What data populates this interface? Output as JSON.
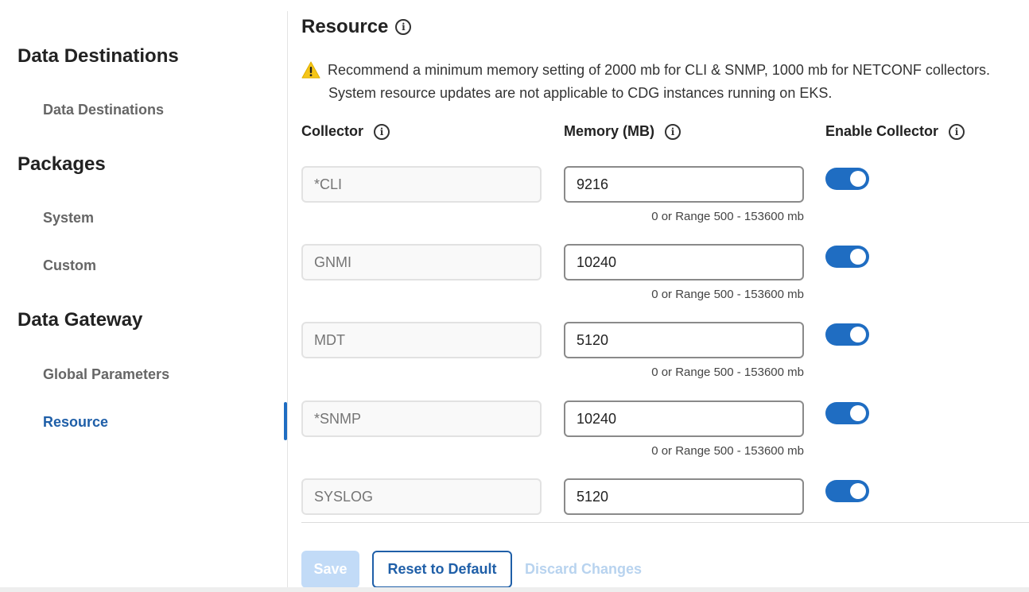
{
  "sidebar": {
    "sections": [
      {
        "heading": "Data Destinations",
        "items": [
          "Data Destinations"
        ]
      },
      {
        "heading": "Packages",
        "items": [
          "System",
          "Custom"
        ]
      },
      {
        "heading": "Data Gateway",
        "items": [
          "Global Parameters",
          "Resource"
        ]
      }
    ],
    "active_item": "Resource"
  },
  "main": {
    "title": "Resource",
    "warning": {
      "line1": "Recommend a minimum memory setting of 2000 mb for CLI & SNMP, 1000 mb for NETCONF collectors.",
      "line2": "System resource updates are not applicable to CDG instances running on EKS."
    },
    "columns": {
      "collector": "Collector",
      "memory": "Memory (MB)",
      "enable": "Enable Collector"
    },
    "rows": [
      {
        "collector": "*CLI",
        "memory": "9216",
        "hint": "0 or Range 500 - 153600 mb",
        "enabled": true
      },
      {
        "collector": "GNMI",
        "memory": "10240",
        "hint": "0 or Range 500 - 153600 mb",
        "enabled": true
      },
      {
        "collector": "MDT",
        "memory": "5120",
        "hint": "0 or Range 500 - 153600 mb",
        "enabled": true
      },
      {
        "collector": "*SNMP",
        "memory": "10240",
        "hint": "0 or Range 500 - 153600 mb",
        "enabled": true
      },
      {
        "collector": "SYSLOG",
        "memory": "5120",
        "hint": "",
        "enabled": true
      }
    ],
    "buttons": {
      "save": "Save",
      "reset": "Reset to Default",
      "discard": "Discard Changes"
    }
  },
  "colors": {
    "accent": "#1f6dc2",
    "warning": "#f5c518",
    "disabled_button": "#c2dbf7"
  },
  "icons": [
    "info-icon",
    "warning-icon"
  ]
}
